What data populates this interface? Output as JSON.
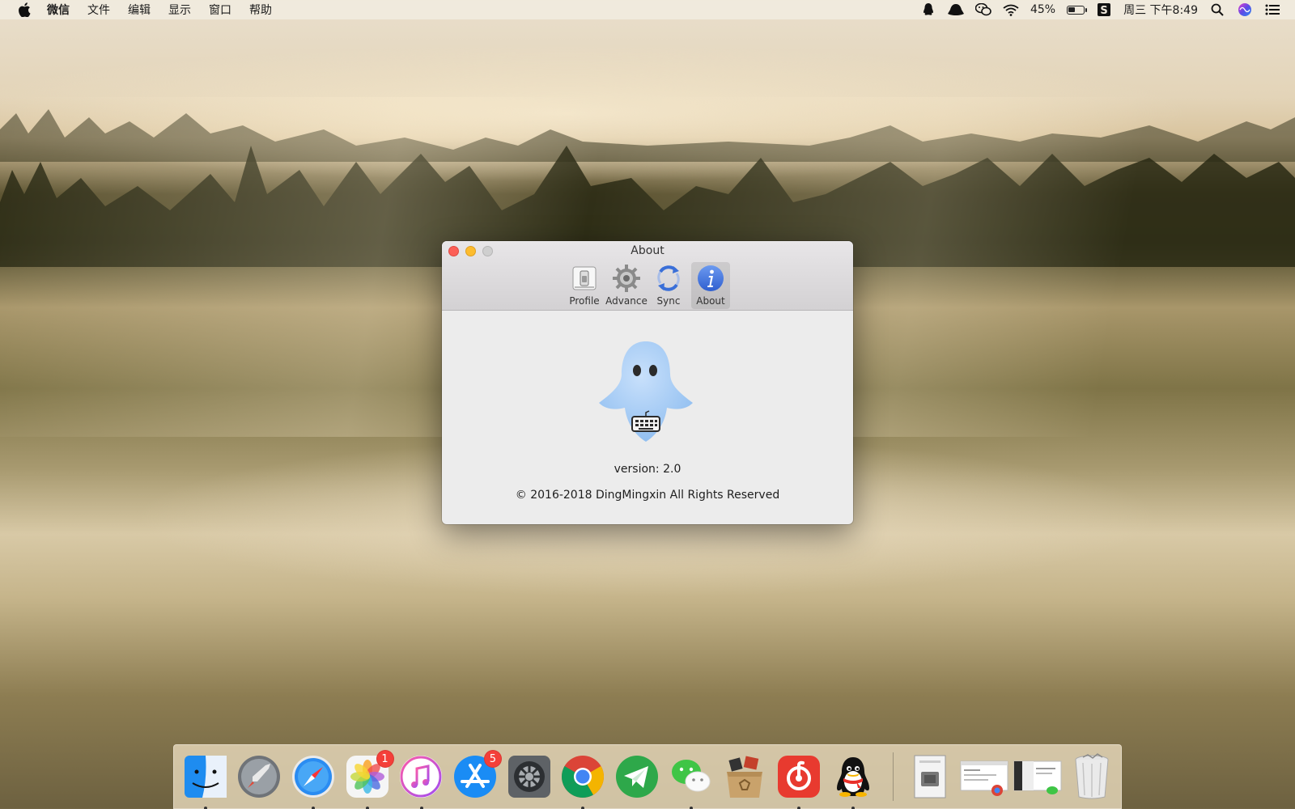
{
  "menubar": {
    "app_name": "微信",
    "items": [
      "文件",
      "编辑",
      "显示",
      "窗口",
      "帮助"
    ],
    "battery_percent": "45%",
    "battery_level": 0.45,
    "datetime": "周三 下午8:49"
  },
  "window": {
    "title": "About",
    "tabs": [
      {
        "label": "Profile",
        "icon": "switch-icon"
      },
      {
        "label": "Advance",
        "icon": "gear-icon"
      },
      {
        "label": "Sync",
        "icon": "sync-icon"
      },
      {
        "label": "About",
        "icon": "info-icon",
        "active": true
      }
    ],
    "version": "version: 2.0",
    "copyright": "© 2016-2018 DingMingxin All Rights Reserved"
  },
  "dock": {
    "apps": [
      {
        "name": "finder-icon",
        "running": true
      },
      {
        "name": "launchpad-icon",
        "running": false
      },
      {
        "name": "safari-icon",
        "running": true
      },
      {
        "name": "photos-icon",
        "running": true,
        "badge": "1"
      },
      {
        "name": "itunes-icon",
        "running": true
      },
      {
        "name": "app-store-icon",
        "running": false,
        "badge": "5"
      },
      {
        "name": "system-preferences-icon",
        "running": false
      },
      {
        "name": "chrome-icon",
        "running": true
      },
      {
        "name": "telegram-icon",
        "running": false
      },
      {
        "name": "wechat-icon",
        "running": true
      },
      {
        "name": "archive-utility-icon",
        "running": false
      },
      {
        "name": "netease-music-icon",
        "running": true
      },
      {
        "name": "qq-icon",
        "running": true
      }
    ],
    "docked_items": [
      "preview-document-icon",
      "chrome-window-thumbnail",
      "wechat-window-thumbnail",
      "trash-icon"
    ]
  },
  "colors": {
    "close": "#fc5f57",
    "minimize": "#fdbc2e",
    "info_blue": "#4a7ee8",
    "ghost_blue": "#a9cdf5"
  }
}
